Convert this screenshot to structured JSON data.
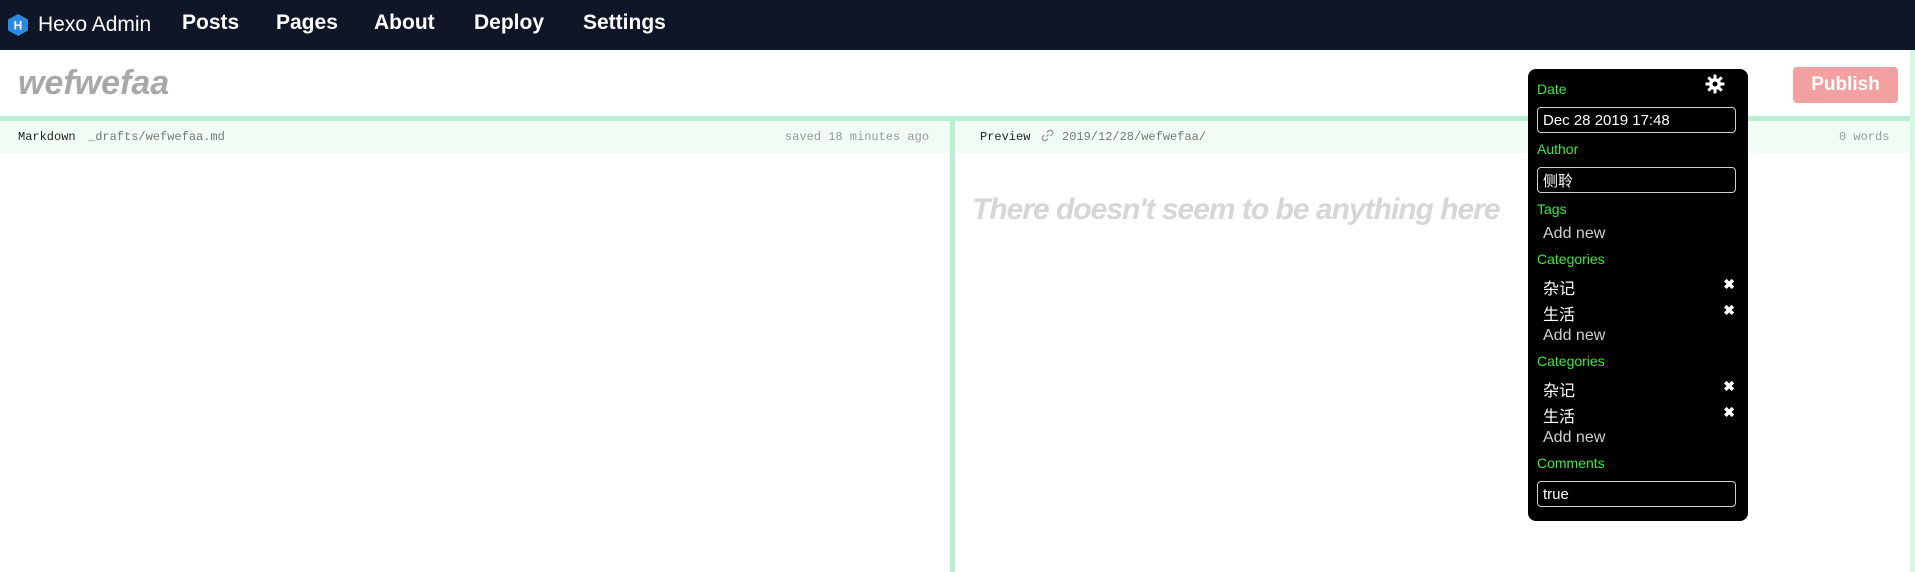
{
  "nav": {
    "brand_letter": "H",
    "brand_name": "Hexo Admin",
    "items": [
      "Posts",
      "Pages",
      "About",
      "Deploy",
      "Settings"
    ]
  },
  "post": {
    "title": "wefwefaa",
    "publish_label": "Publish"
  },
  "markdown_pane": {
    "label": "Markdown",
    "path": "_drafts/wefwefaa.md",
    "status": "saved 18 minutes ago"
  },
  "preview_pane": {
    "label": "Preview",
    "url": "2019/12/28/wefwefaa/",
    "word_count": "0 words",
    "empty_message": "There doesn't seem to be anything here"
  },
  "settings": {
    "date_label": "Date",
    "date_value": "Dec 28 2019 17:48",
    "author_label": "Author",
    "author_value": "侧聆",
    "tags_label": "Tags",
    "tags_add": "Add new",
    "categories_label": "Categories",
    "categories": [
      "杂记",
      "生活"
    ],
    "categories_add": "Add new",
    "categories2_label": "Categories",
    "categories2": [
      "杂记",
      "生活"
    ],
    "categories2_add": "Add new",
    "comments_label": "Comments",
    "comments_value": "true"
  },
  "colors": {
    "nav_bg": "#0e1628",
    "accent_green": "#3ee83e",
    "publish_bg": "#f2a0a0",
    "divider": "#b8f0cf",
    "logo_blue": "#2a8ae0"
  },
  "icons": {
    "logo": "hexo-hexagon-icon",
    "settings": "gear-icon",
    "link": "link-icon",
    "remove": "close-icon"
  }
}
